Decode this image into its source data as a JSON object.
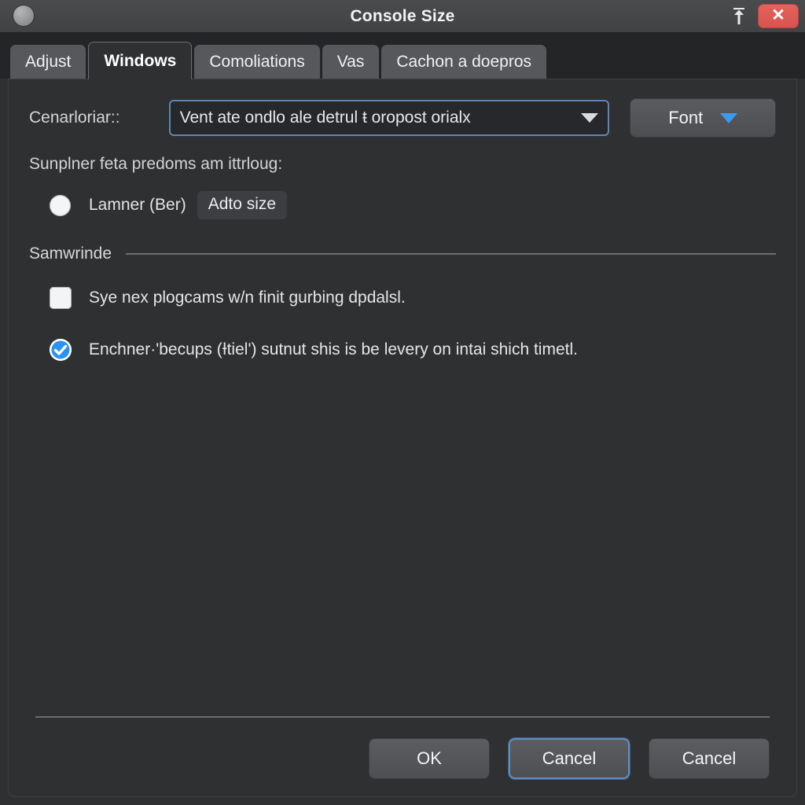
{
  "window": {
    "title": "Console Size",
    "traffic_dot": "window-dot",
    "upload_icon": "upload-arrow-icon",
    "close_icon": "close-icon",
    "close_color": "#d9534f"
  },
  "tabs": [
    {
      "label": "Adjust",
      "active": false
    },
    {
      "label": "Windows",
      "active": true
    },
    {
      "label": "Comoliations",
      "active": false
    },
    {
      "label": "Vas",
      "active": false
    },
    {
      "label": "Cachon a doepros",
      "active": false
    }
  ],
  "combo_row": {
    "label": "Cenarloriar::",
    "value": "Vent ate ondlo ale detrul ŧ oropost orialx",
    "arrow_icon": "chevron-down-icon",
    "font_button_label": "Font",
    "font_button_arrow_icon": "chevron-down-icon",
    "accent_color": "#3a9bf0",
    "focus_border_color": "#5d86b5"
  },
  "sub_label": "Sunplner feta predoms am ittrloug:",
  "radio_row": {
    "label": "Lamner (Ber)",
    "inline_button_label": "Adto size",
    "selected": false
  },
  "group": {
    "title": "Samwrinde"
  },
  "checkboxes": [
    {
      "label": "Sye nex plogcams w/n finit gurbing dpdalsl.",
      "checked": false
    },
    {
      "label": "Enchner·'becups (Ɨtiel') sutnut shis is be levery on intai shich timetl.",
      "checked": true
    }
  ],
  "footer": {
    "buttons": [
      {
        "label": "OK",
        "focused": false
      },
      {
        "label": "Cancel",
        "focused": true
      },
      {
        "label": "Cancel",
        "focused": false
      }
    ]
  }
}
